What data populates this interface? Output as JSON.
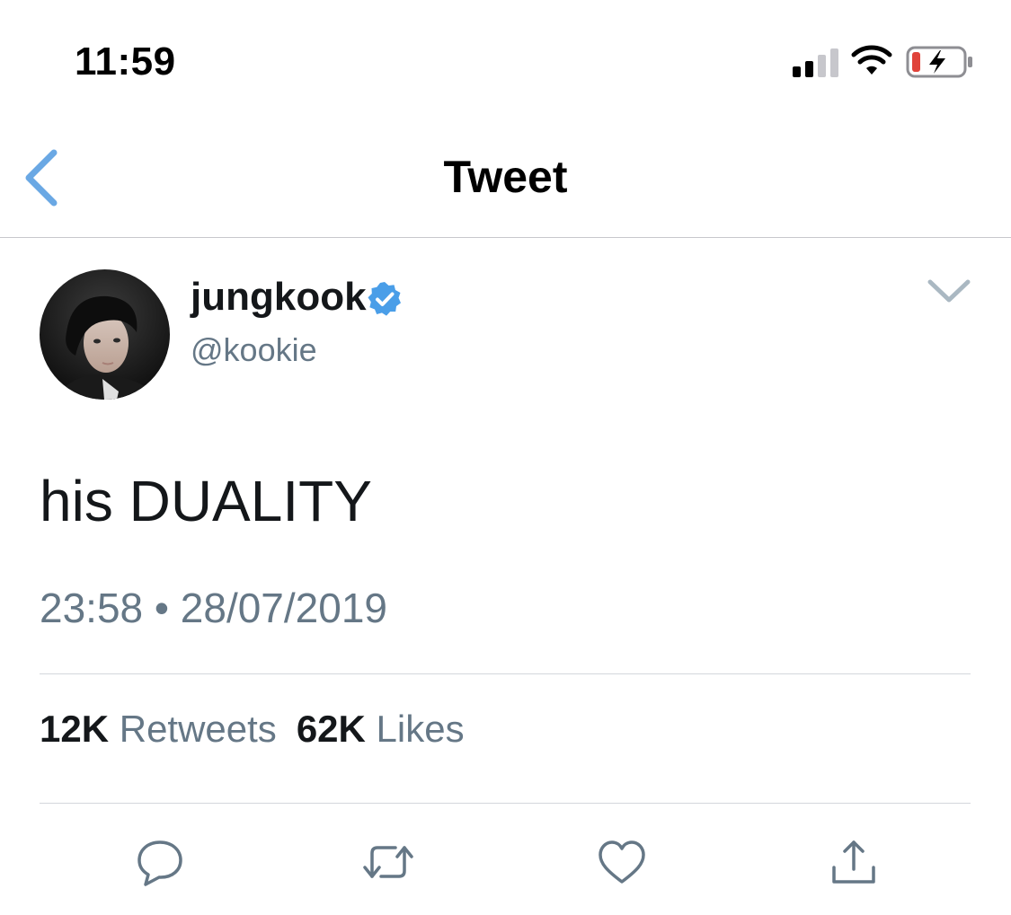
{
  "status_bar": {
    "time": "11:59",
    "icons": [
      "cellular-signal-icon",
      "wifi-icon",
      "battery-charging-icon"
    ],
    "battery_color": "#e0433a"
  },
  "nav": {
    "title": "Tweet",
    "back_icon": "chevron-left-icon",
    "accent": "#6aa8e4"
  },
  "author": {
    "display_name": "jungkook",
    "handle": "@kookie",
    "verified_badge": "verified-badge-icon",
    "verified_color": "#4a9ee8"
  },
  "tweet": {
    "text": "his DUALITY",
    "timestamp": "23:58 • 28/07/2019"
  },
  "stats": {
    "retweets_count": "12K",
    "retweets_label": "Retweets",
    "likes_count": "62K",
    "likes_label": "Likes"
  },
  "actions": [
    "reply-icon",
    "retweet-icon",
    "like-icon",
    "share-icon"
  ]
}
